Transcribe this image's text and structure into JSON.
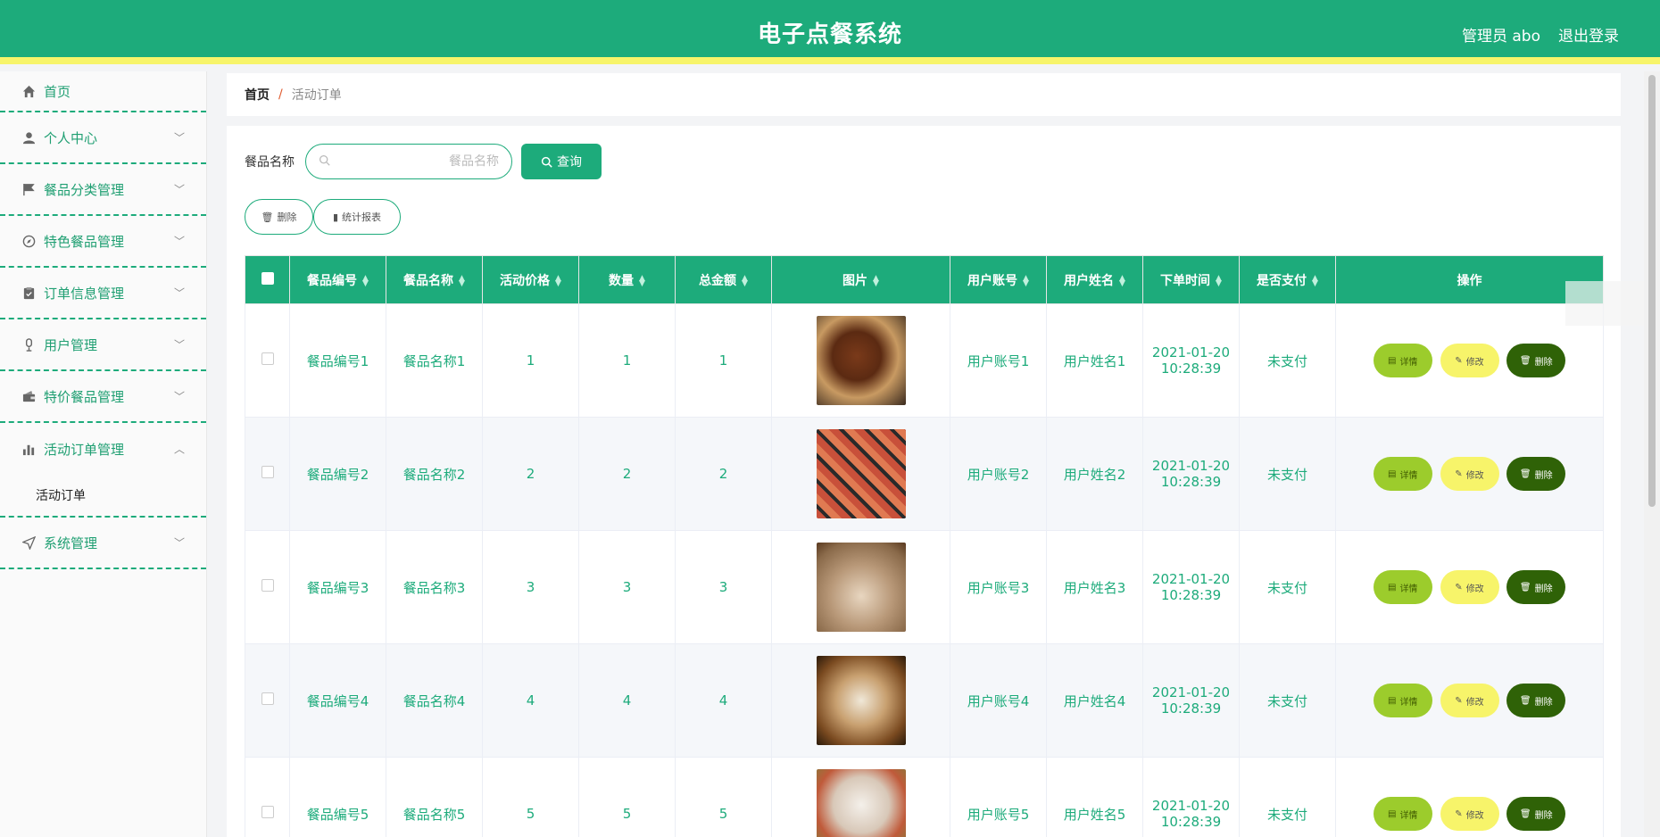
{
  "header": {
    "title": "电子点餐系统",
    "user": "管理员 abo",
    "logout": "退出登录"
  },
  "sidebar": {
    "items": [
      {
        "label": "首页",
        "icon": "home-icon"
      },
      {
        "label": "个人中心",
        "icon": "user-icon"
      },
      {
        "label": "餐品分类管理",
        "icon": "flag-icon"
      },
      {
        "label": "特色餐品管理",
        "icon": "compass-icon"
      },
      {
        "label": "订单信息管理",
        "icon": "clipboard-icon"
      },
      {
        "label": "用户管理",
        "icon": "microphone-icon"
      },
      {
        "label": "特价餐品管理",
        "icon": "wallet-icon"
      },
      {
        "label": "活动订单管理",
        "icon": "bar-chart-icon"
      },
      {
        "label": "系统管理",
        "icon": "send-icon"
      }
    ],
    "submenu": "活动订单"
  },
  "breadcrumb": {
    "home": "首页",
    "separator": "/",
    "current": "活动订单"
  },
  "search": {
    "label": "餐品名称",
    "placeholder": "餐品名称",
    "button": "查询"
  },
  "actions": {
    "delete": "删除",
    "stats": "统计报表"
  },
  "table": {
    "headers": [
      "餐品编号",
      "餐品名称",
      "活动价格",
      "数量",
      "总金额",
      "图片",
      "用户账号",
      "用户姓名",
      "下单时间",
      "是否支付",
      "操作"
    ],
    "rows": [
      {
        "code": "餐品编号1",
        "name": "餐品名称1",
        "price": "1",
        "qty": "1",
        "total": "1",
        "account": "用户账号1",
        "username": "用户姓名1",
        "date": "2021-01-20",
        "time": "10:28:39",
        "paid": "未支付"
      },
      {
        "code": "餐品编号2",
        "name": "餐品名称2",
        "price": "2",
        "qty": "2",
        "total": "2",
        "account": "用户账号2",
        "username": "用户姓名2",
        "date": "2021-01-20",
        "time": "10:28:39",
        "paid": "未支付"
      },
      {
        "code": "餐品编号3",
        "name": "餐品名称3",
        "price": "3",
        "qty": "3",
        "total": "3",
        "account": "用户账号3",
        "username": "用户姓名3",
        "date": "2021-01-20",
        "time": "10:28:39",
        "paid": "未支付"
      },
      {
        "code": "餐品编号4",
        "name": "餐品名称4",
        "price": "4",
        "qty": "4",
        "total": "4",
        "account": "用户账号4",
        "username": "用户姓名4",
        "date": "2021-01-20",
        "time": "10:28:39",
        "paid": "未支付"
      },
      {
        "code": "餐品编号5",
        "name": "餐品名称5",
        "price": "5",
        "qty": "5",
        "total": "5",
        "account": "用户账号5",
        "username": "用户姓名5",
        "date": "2021-01-20",
        "time": "10:28:39",
        "paid": "未支付"
      }
    ],
    "ops": {
      "detail": "详情",
      "edit": "修改",
      "delete": "删除"
    }
  },
  "colors": {
    "primary": "#1dab7b",
    "accent": "#f7f46a",
    "detail": "#9ccc2c",
    "danger": "#2f6207"
  }
}
